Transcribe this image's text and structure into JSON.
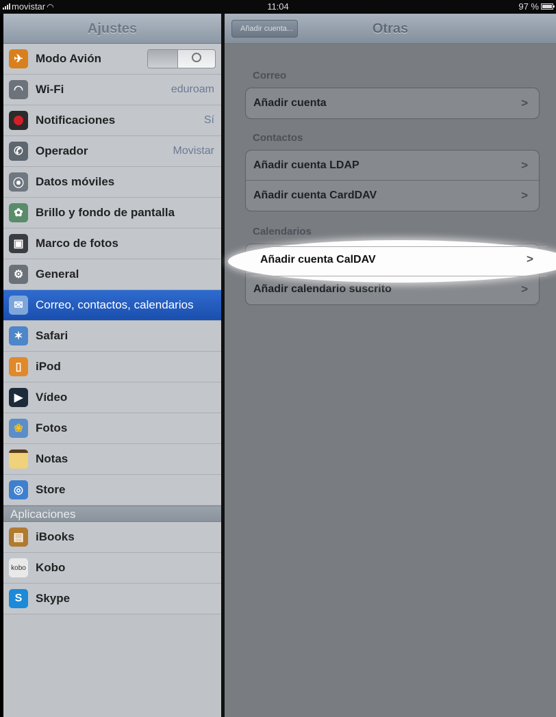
{
  "statusbar": {
    "carrier": "movistar",
    "time": "11:04",
    "battery": "97 %"
  },
  "master": {
    "title": "Ajustes",
    "items": [
      {
        "label": "Modo Avión",
        "value": "",
        "icon": "airplane-icon"
      },
      {
        "label": "Wi-Fi",
        "value": "eduroam",
        "icon": "wifi-icon"
      },
      {
        "label": "Notificaciones",
        "value": "Sí",
        "icon": "notifications-icon"
      },
      {
        "label": "Operador",
        "value": "Movistar",
        "icon": "phone-icon"
      },
      {
        "label": "Datos móviles",
        "value": "",
        "icon": "antenna-icon"
      },
      {
        "label": "Brillo y fondo de pantalla",
        "value": "",
        "icon": "flower-icon"
      },
      {
        "label": "Marco de fotos",
        "value": "",
        "icon": "photo-frame-icon"
      },
      {
        "label": "General",
        "value": "",
        "icon": "gear-icon"
      },
      {
        "label": "Correo, contactos, calendarios",
        "value": "",
        "icon": "mail-icon"
      },
      {
        "label": "Safari",
        "value": "",
        "icon": "compass-icon"
      },
      {
        "label": "iPod",
        "value": "",
        "icon": "ipod-icon"
      },
      {
        "label": "Vídeo",
        "value": "",
        "icon": "video-icon"
      },
      {
        "label": "Fotos",
        "value": "",
        "icon": "sunflower-icon"
      },
      {
        "label": "Notas",
        "value": "",
        "icon": "notepad-icon"
      },
      {
        "label": "Store",
        "value": "",
        "icon": "app-store-icon"
      }
    ],
    "apps_header": "Aplicaciones",
    "apps": [
      {
        "label": "iBooks",
        "icon": "book-icon"
      },
      {
        "label": "Kobo",
        "icon": "kobo-logo"
      },
      {
        "label": "Skype",
        "icon": "skype-logo"
      }
    ]
  },
  "detail": {
    "back": "Añadir cuenta...",
    "title": "Otras",
    "sections": [
      {
        "header": "Correo",
        "items": [
          "Añadir cuenta"
        ]
      },
      {
        "header": "Contactos",
        "items": [
          "Añadir cuenta LDAP",
          "Añadir cuenta CardDAV"
        ]
      },
      {
        "header": "Calendarios",
        "items": [
          "Añadir cuenta CalDAV",
          "Añadir calendario suscrito"
        ]
      }
    ],
    "chevron": ">"
  },
  "toggle_state": "off",
  "colors": {
    "selected": "#2563c4",
    "highlight": "#ffffff"
  }
}
